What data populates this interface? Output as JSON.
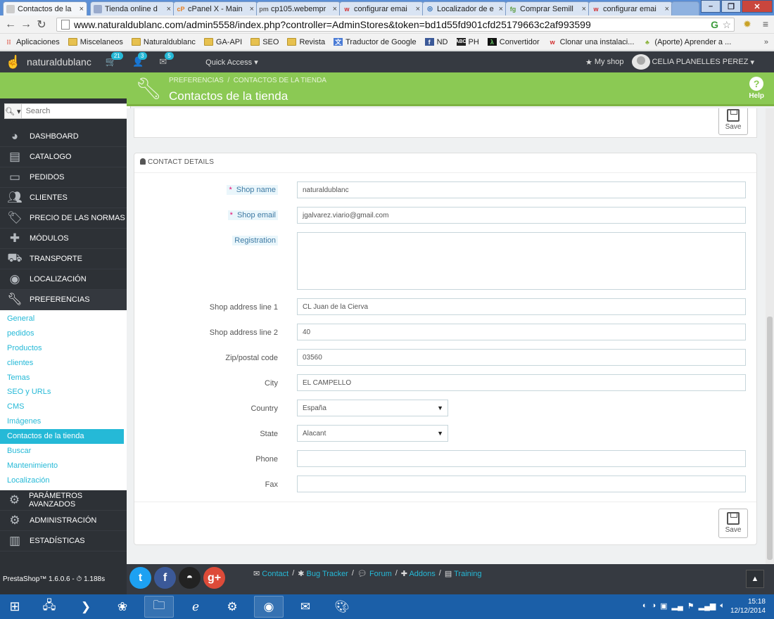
{
  "browser": {
    "tabs": [
      {
        "title": "Contactos de la",
        "icon": "page-icon",
        "active": true
      },
      {
        "title": "Tienda online d",
        "icon": "page-icon"
      },
      {
        "title": "cPanel X - Main",
        "icon": "cpanel-icon"
      },
      {
        "title": "cp105.webempr",
        "icon": "pma-icon"
      },
      {
        "title": "configurar emai",
        "icon": "w-icon"
      },
      {
        "title": "Localizador de e",
        "icon": "locator-icon"
      },
      {
        "title": "Comprar Semill",
        "icon": "fg-icon"
      },
      {
        "title": "configurar emai",
        "icon": "w-icon"
      }
    ],
    "url": "www.naturaldublanc.com/admin5558/index.php?controller=AdminStores&token=bd1d55fd901cfd25179663c2af993599",
    "bookmarks": [
      {
        "label": "Aplicaciones",
        "icon": "apps-icon"
      },
      {
        "label": "Miscelaneos",
        "icon": "folder-icon"
      },
      {
        "label": "Naturaldublanc",
        "icon": "folder-icon"
      },
      {
        "label": "GA-API",
        "icon": "folder-icon"
      },
      {
        "label": "SEO",
        "icon": "folder-icon"
      },
      {
        "label": "Revista",
        "icon": "folder-icon"
      },
      {
        "label": "Traductor de Google",
        "icon": "translate-icon"
      },
      {
        "label": "ND",
        "icon": "facebook-icon"
      },
      {
        "label": "PH",
        "icon": "abc-icon"
      },
      {
        "label": "Convertidor",
        "icon": "lambda-icon"
      },
      {
        "label": "Clonar una instalaci...",
        "icon": "w-icon"
      },
      {
        "label": "(Aporte) Aprender a ...",
        "icon": "android-icon"
      }
    ],
    "more": "»"
  },
  "header": {
    "shop_name": "naturaldublanc",
    "orders_count": "21",
    "customers_count": "3",
    "messages_count": "5",
    "quick_access": "Quick Access",
    "my_shop": "My shop",
    "user_name": "CELIA PLANELLES PEREZ"
  },
  "toolbar": {
    "breadcrumb_parent": "PREFERENCIAS",
    "breadcrumb_sep": "/",
    "breadcrumb_current": "CONTACTOS DE LA TIENDA",
    "title": "Contactos de la tienda",
    "help": "Help"
  },
  "sidebar": {
    "search_placeholder": "Search",
    "menu": [
      {
        "label": "DASHBOARD",
        "icon": "dashboard-icon"
      },
      {
        "label": "CATALOGO",
        "icon": "book-icon"
      },
      {
        "label": "PEDIDOS",
        "icon": "credit-card-icon"
      },
      {
        "label": "CLIENTES",
        "icon": "users-icon"
      },
      {
        "label": "PRECIO DE LAS NORMAS",
        "icon": "tags-icon"
      },
      {
        "label": "MÓDULOS",
        "icon": "puzzle-icon"
      },
      {
        "label": "TRANSPORTE",
        "icon": "truck-icon"
      },
      {
        "label": "LOCALIZACIÓN",
        "icon": "globe-icon"
      },
      {
        "label": "PREFERENCIAS",
        "icon": "wrench-icon"
      }
    ],
    "submenu": [
      "General",
      "pedidos",
      "Productos",
      "clientes",
      "Temas",
      "SEO y URLs",
      "CMS",
      "Imágenes",
      "Contactos de la tienda",
      "Buscar",
      "Mantenimiento",
      "Localización"
    ],
    "menu_after": [
      {
        "label": "PARÁMETROS AVANZADOS",
        "icon": "cogs-icon"
      },
      {
        "label": "ADMINISTRACIÓN",
        "icon": "gear-icon"
      },
      {
        "label": "ESTADÍSTICAS",
        "icon": "chart-icon"
      }
    ],
    "version": "PrestaShop™ 1.6.0.6 - ⏱ 1.188s"
  },
  "form": {
    "save_label": "Save",
    "section_title": "CONTACT DETAILS",
    "fields": {
      "shop_name": {
        "label": "Shop name",
        "value": "naturaldublanc",
        "required": "*"
      },
      "shop_email": {
        "label": "Shop email",
        "value": "jgalvarez.viario@gmail.com",
        "required": "*"
      },
      "registration": {
        "label": "Registration",
        "value": ""
      },
      "address1": {
        "label": "Shop address line 1",
        "value": "CL Juan de la Cierva"
      },
      "address2": {
        "label": "Shop address line 2",
        "value": "40"
      },
      "zip": {
        "label": "Zip/postal code",
        "value": "03560"
      },
      "city": {
        "label": "City",
        "value": "EL CAMPELLO"
      },
      "country": {
        "label": "Country",
        "value": "España"
      },
      "state": {
        "label": "State",
        "value": "Alacant"
      },
      "phone": {
        "label": "Phone",
        "value": ""
      },
      "fax": {
        "label": "Fax",
        "value": ""
      }
    }
  },
  "footer": {
    "links": [
      "Contact",
      "Bug Tracker",
      "Forum",
      "Addons",
      "Training"
    ],
    "separator": "/"
  },
  "taskbar": {
    "time": "15:18",
    "date": "12/12/2014"
  },
  "colors": {
    "accent": "#25b9d7",
    "toolbar": "#8bc954",
    "dark": "#363a41",
    "required": "#e50b70"
  }
}
